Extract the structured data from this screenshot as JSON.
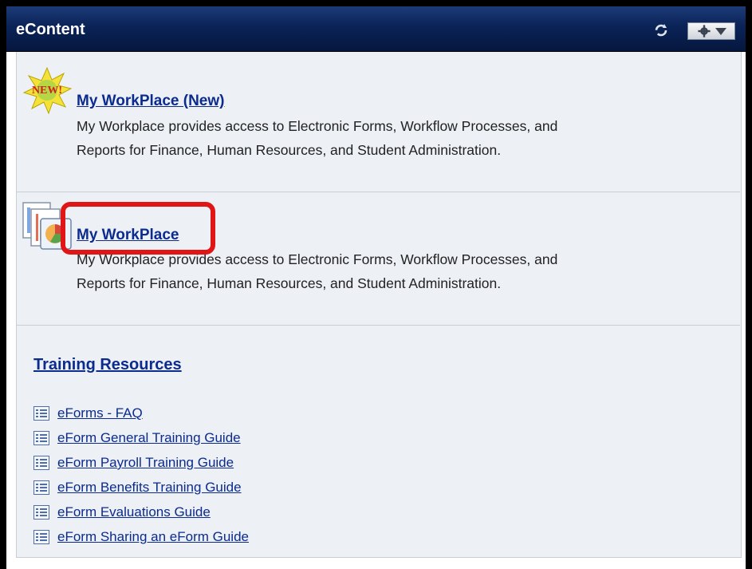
{
  "header": {
    "title": "eContent",
    "refresh_icon": "refresh-icon",
    "settings_icon": "gear-icon",
    "dropdown_icon": "chevron-down-icon"
  },
  "items": [
    {
      "badge": "NEW!",
      "title": "My WorkPlace (New)",
      "description_line1": "My Workplace provides access to Electronic Forms, Workflow Processes, and",
      "description_line2": "Reports for Finance, Human Resources, and Student Administration."
    },
    {
      "title": "My WorkPlace",
      "description_line1": "My Workplace provides access to Electronic Forms, Workflow Processes, and",
      "description_line2": "Reports for Finance, Human Resources, and Student Administration.",
      "highlighted": true
    }
  ],
  "training": {
    "title": "Training Resources",
    "resources": [
      "eForms - FAQ",
      "eForm General Training Guide",
      "eForm Payroll Training Guide",
      "eForm Benefits Training Guide",
      "eForm Evaluations Guide",
      "eForm Sharing an eForm Guide"
    ]
  },
  "colors": {
    "header_bg": "#0a2357",
    "link": "#0b2b8e",
    "highlight": "#e01616",
    "content_bg": "#edf0f5"
  }
}
